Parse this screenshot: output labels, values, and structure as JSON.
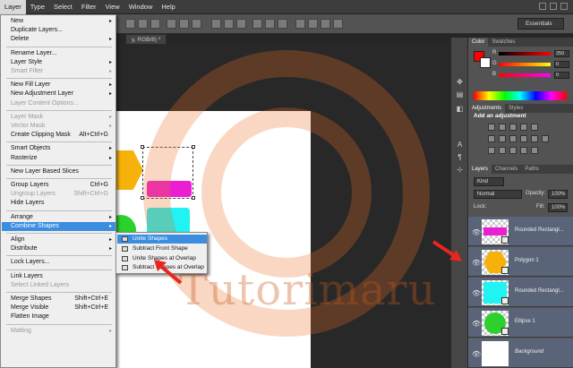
{
  "menubar": {
    "items": [
      "Layer",
      "Type",
      "Select",
      "Filter",
      "View",
      "Window",
      "Help"
    ]
  },
  "workspace": {
    "label": "Essentials"
  },
  "document": {
    "tab_title": "y, RGB/8) *"
  },
  "layer_menu": {
    "items": [
      {
        "label": "New",
        "arrow": "▸"
      },
      {
        "label": "Duplicate Layers..."
      },
      {
        "label": "Delete",
        "arrow": "▸"
      },
      {
        "label": "Rename Layer..."
      },
      {
        "label": "Layer Style",
        "arrow": "▸"
      },
      {
        "label": "Smart Filter",
        "disabled": true,
        "arrow": "▸"
      },
      {
        "label": "New Fill Layer",
        "arrow": "▸"
      },
      {
        "label": "New Adjustment Layer",
        "arrow": "▸"
      },
      {
        "label": "Layer Content Options...",
        "disabled": true
      },
      {
        "label": "Layer Mask",
        "disabled": true,
        "arrow": "▸"
      },
      {
        "label": "Vector Mask",
        "disabled": true,
        "arrow": "▸"
      },
      {
        "label": "Create Clipping Mask",
        "shortcut": "Alt+Ctrl+G"
      },
      {
        "label": "Smart Objects",
        "arrow": "▸"
      },
      {
        "label": "Rasterize",
        "arrow": "▸"
      },
      {
        "label": "New Layer Based Slices"
      },
      {
        "label": "Group Layers",
        "shortcut": "Ctrl+G"
      },
      {
        "label": "Ungroup Layers",
        "shortcut": "Shift+Ctrl+G",
        "disabled": true
      },
      {
        "label": "Hide Layers"
      },
      {
        "label": "Arrange",
        "arrow": "▸"
      },
      {
        "label": "Combine Shapes",
        "arrow": "▸",
        "highlighted": true
      },
      {
        "label": "Align",
        "arrow": "▸"
      },
      {
        "label": "Distribute",
        "arrow": "▸"
      },
      {
        "label": "Lock Layers..."
      },
      {
        "label": "Link Layers"
      },
      {
        "label": "Select Linked Layers",
        "disabled": true
      },
      {
        "label": "Merge Shapes",
        "shortcut": "Shift+Ctrl+E"
      },
      {
        "label": "Merge Visible",
        "shortcut": "Shift+Ctrl+E"
      },
      {
        "label": "Flatten Image"
      },
      {
        "label": "Matting",
        "disabled": true,
        "arrow": "▸"
      }
    ]
  },
  "combine_submenu": {
    "items": [
      {
        "label": "Unite Shapes",
        "highlighted": true
      },
      {
        "label": "Subtract Front Shape"
      },
      {
        "label": "Unite Shapes at Overlap"
      },
      {
        "label": "Subtract Shapes at Overlap"
      }
    ]
  },
  "panels": {
    "color_tabs": [
      "Color",
      "Swatches"
    ],
    "color": {
      "r": {
        "label": "R",
        "value": "250"
      },
      "g": {
        "label": "G",
        "value": "0"
      },
      "b": {
        "label": "B",
        "value": "0"
      },
      "fg": "#ff0000",
      "bg": "#ffffff"
    },
    "adjust_tabs": [
      "Adjustments",
      "Styles"
    ],
    "adjust_title": "Add an adjustment",
    "layer_tabs": [
      "Layers",
      "Channels",
      "Paths"
    ],
    "kind": "Kind",
    "blend_mode": "Normal",
    "opacity_label": "Opacity:",
    "opacity": "100%",
    "lock_label": "Lock:",
    "fill_label": "Fill:",
    "fill": "100%",
    "layers": [
      {
        "name": "Rounded Rectangl...",
        "color": "#ea1fd1",
        "kind": "rect"
      },
      {
        "name": "Polygon 1",
        "color": "#f6b20b",
        "kind": "hex"
      },
      {
        "name": "Rounded Rectangl...",
        "color": "#21f2f2",
        "kind": "rect"
      },
      {
        "name": "Ellipse 1",
        "color": "#2dd12d",
        "kind": "circle"
      },
      {
        "name": "Background",
        "color": "#ffffff",
        "kind": "bg"
      }
    ]
  },
  "watermark": "Tutorimaru",
  "colors": {
    "menu_highlight": "#3b8de0",
    "annotation_arrow": "#e8251f"
  }
}
